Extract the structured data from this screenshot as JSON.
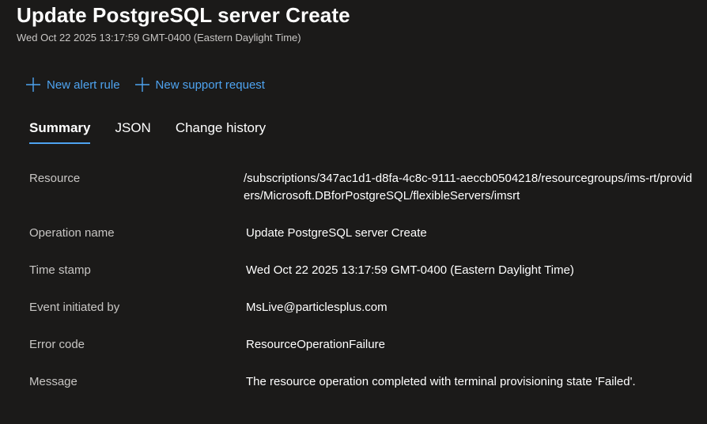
{
  "header": {
    "title": "Update PostgreSQL server Create",
    "subtitle": "Wed Oct 22 2025 13:17:59 GMT-0400 (Eastern Daylight Time)"
  },
  "toolbar": {
    "new_alert_rule": "New alert rule",
    "new_support_request": "New support request"
  },
  "tabs": [
    {
      "label": "Summary",
      "active": true
    },
    {
      "label": "JSON",
      "active": false
    },
    {
      "label": "Change history",
      "active": false
    }
  ],
  "summary": {
    "resource": {
      "label": "Resource",
      "value": "/subscriptions/347ac1d1-d8fa-4c8c-9111-aeccb0504218/resourcegroups/ims-rt/providers/Microsoft.DBforPostgreSQL/flexibleServers/imsrt"
    },
    "operation_name": {
      "label": "Operation name",
      "value": "Update PostgreSQL server Create"
    },
    "time_stamp": {
      "label": "Time stamp",
      "value": "Wed Oct 22 2025 13:17:59 GMT-0400 (Eastern Daylight Time)"
    },
    "event_initiated_by": {
      "label": "Event initiated by",
      "value": "MsLive@particlesplus.com"
    },
    "error_code": {
      "label": "Error code",
      "value": "ResourceOperationFailure"
    },
    "message": {
      "label": "Message",
      "value": "The resource operation completed with terminal provisioning state 'Failed'."
    }
  },
  "colors": {
    "background": "#1b1a19",
    "accent": "#4ea3f0",
    "label_text": "#c8c6c4",
    "value_text": "#ffffff"
  }
}
